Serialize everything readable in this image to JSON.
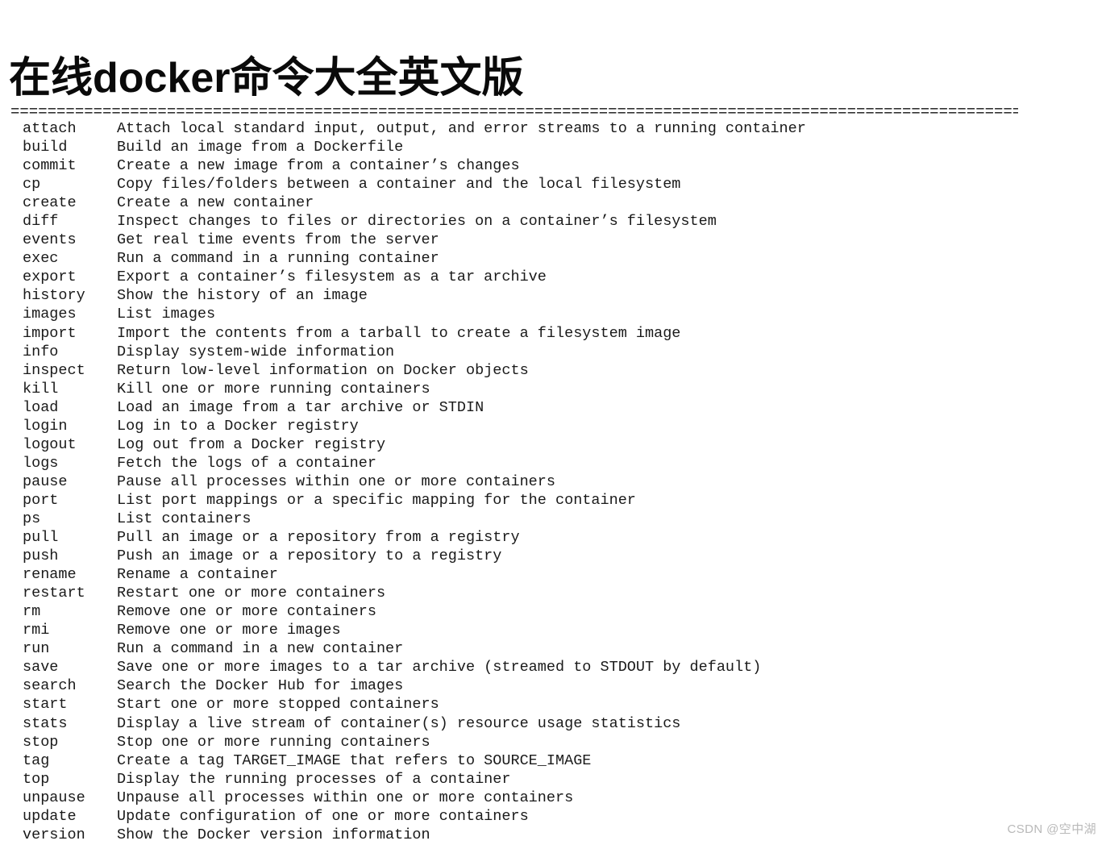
{
  "document": {
    "title": "在线docker命令大全英文版",
    "separator": "====================================================================================================================================================",
    "watermark": "CSDN @空中湖"
  },
  "commands": [
    {
      "name": "attach",
      "desc": "Attach local standard input, output, and error streams to a running container"
    },
    {
      "name": "build",
      "desc": "Build an image from a Dockerfile"
    },
    {
      "name": "commit",
      "desc": "Create a new image from a container’s changes"
    },
    {
      "name": "cp",
      "desc": "Copy files/folders between a container and the local filesystem"
    },
    {
      "name": "create",
      "desc": "Create a new container"
    },
    {
      "name": "diff",
      "desc": "Inspect changes to files or directories on a container’s filesystem"
    },
    {
      "name": "events",
      "desc": "Get real time events from the server"
    },
    {
      "name": "exec",
      "desc": "Run a command in a running container"
    },
    {
      "name": "export",
      "desc": "Export a container’s filesystem as a tar archive"
    },
    {
      "name": "history",
      "desc": "Show the history of an image"
    },
    {
      "name": "images",
      "desc": "List images"
    },
    {
      "name": "import",
      "desc": "Import the contents from a tarball to create a filesystem image"
    },
    {
      "name": "info",
      "desc": "Display system-wide information"
    },
    {
      "name": "inspect",
      "desc": "Return low-level information on Docker objects"
    },
    {
      "name": "kill",
      "desc": "Kill one or more running containers"
    },
    {
      "name": "load",
      "desc": "Load an image from a tar archive or STDIN"
    },
    {
      "name": "login",
      "desc": "Log in to a Docker registry"
    },
    {
      "name": "logout",
      "desc": "Log out from a Docker registry"
    },
    {
      "name": "logs",
      "desc": "Fetch the logs of a container"
    },
    {
      "name": "pause",
      "desc": "Pause all processes within one or more containers"
    },
    {
      "name": "port",
      "desc": "List port mappings or a specific mapping for the container"
    },
    {
      "name": "ps",
      "desc": "List containers"
    },
    {
      "name": "pull",
      "desc": "Pull an image or a repository from a registry"
    },
    {
      "name": "push",
      "desc": "Push an image or a repository to a registry"
    },
    {
      "name": "rename",
      "desc": "Rename a container"
    },
    {
      "name": "restart",
      "desc": "Restart one or more containers"
    },
    {
      "name": "rm",
      "desc": "Remove one or more containers"
    },
    {
      "name": "rmi",
      "desc": "Remove one or more images"
    },
    {
      "name": "run",
      "desc": "Run a command in a new container"
    },
    {
      "name": "save",
      "desc": "Save one or more images to a tar archive (streamed to STDOUT by default)"
    },
    {
      "name": "search",
      "desc": "Search the Docker Hub for images"
    },
    {
      "name": "start",
      "desc": "Start one or more stopped containers"
    },
    {
      "name": "stats",
      "desc": "Display a live stream of container(s) resource usage statistics"
    },
    {
      "name": "stop",
      "desc": "Stop one or more running containers"
    },
    {
      "name": "tag",
      "desc": "Create a tag TARGET_IMAGE that refers to SOURCE_IMAGE"
    },
    {
      "name": "top",
      "desc": "Display the running processes of a container"
    },
    {
      "name": "unpause",
      "desc": "Unpause all processes within one or more containers"
    },
    {
      "name": "update",
      "desc": "Update configuration of one or more containers"
    },
    {
      "name": "version",
      "desc": "Show the Docker version information"
    }
  ],
  "colors": {
    "background": "#ffffff",
    "text": "#1a1a1a",
    "title": "#0a0a0a",
    "watermark": "#b9b9b9"
  }
}
